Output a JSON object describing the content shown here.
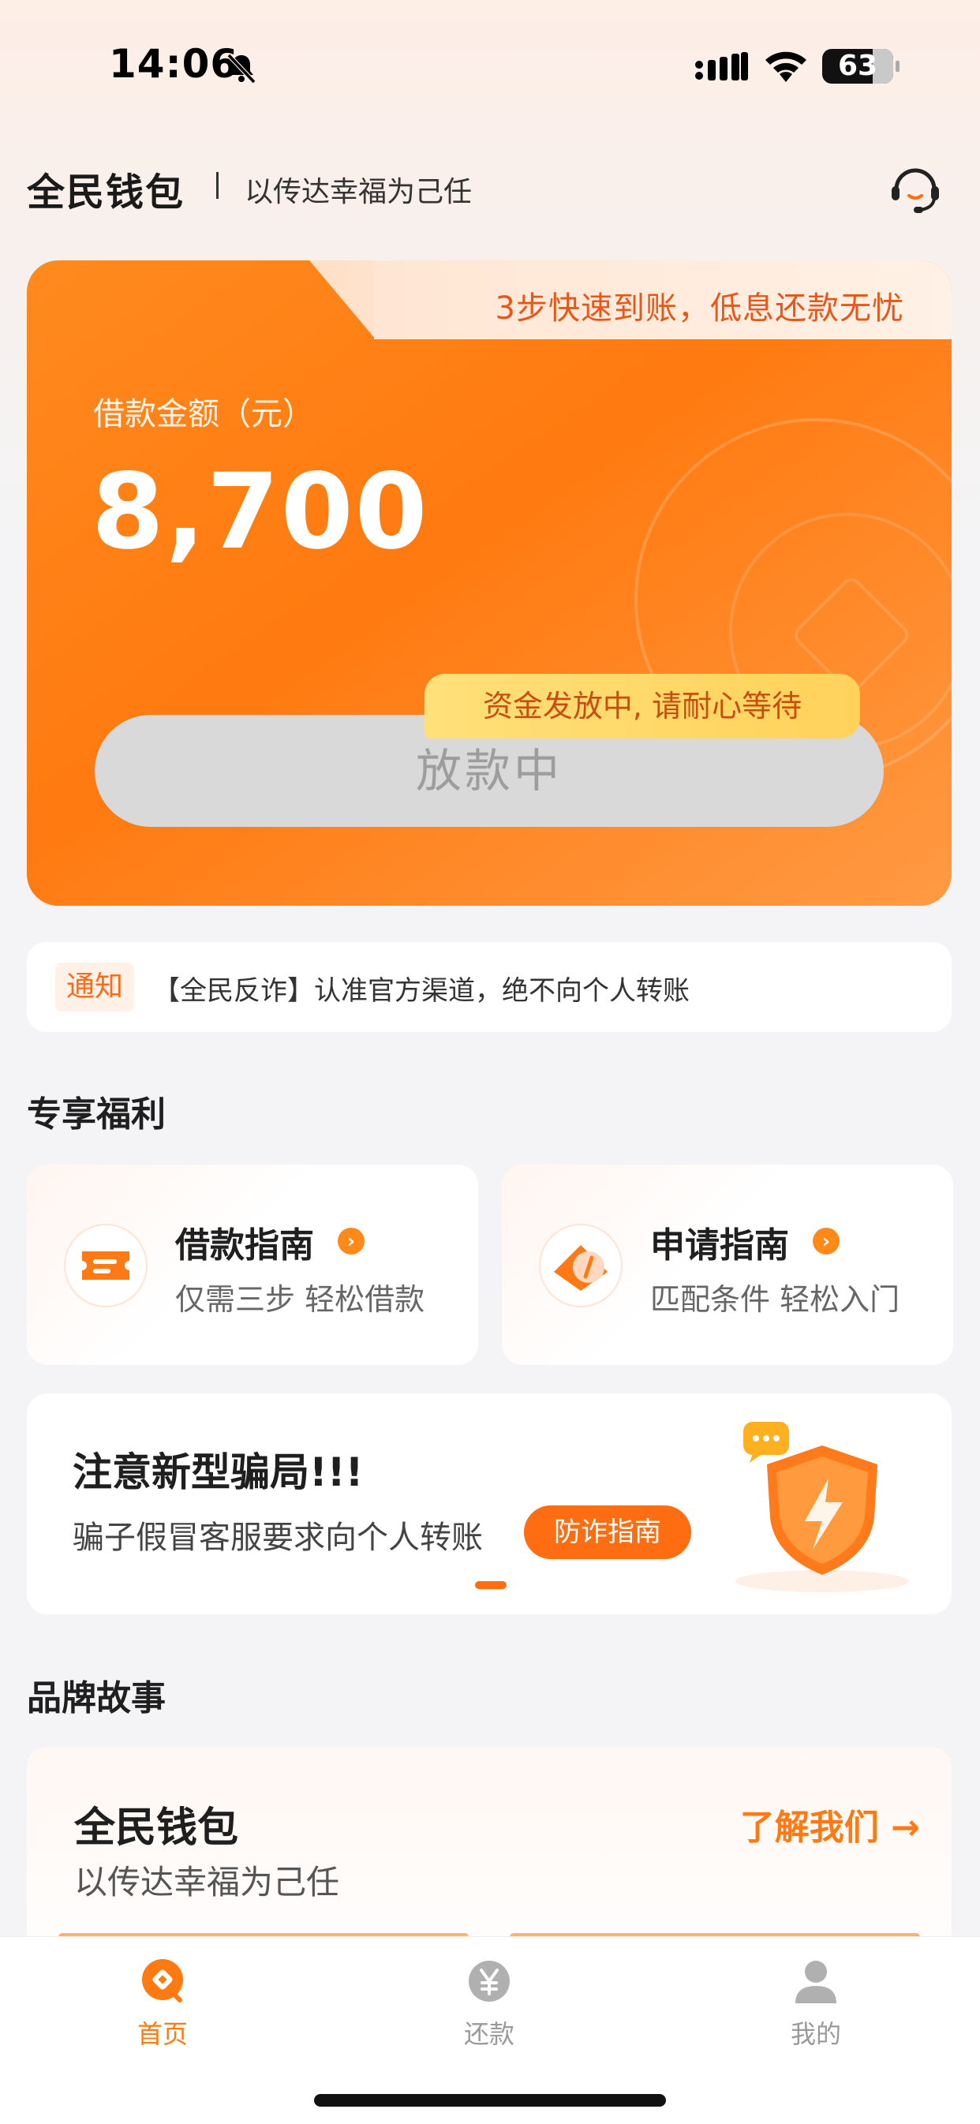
{
  "status_bar": {
    "time": "14:06",
    "battery": "63"
  },
  "header": {
    "brand": "全民钱包",
    "slogan": "以传达幸福为己任"
  },
  "loan_card": {
    "promo": "3步快速到账，低息还款无忧",
    "amount_label": "借款金额（元）",
    "amount": "8,700",
    "tooltip": "资金发放中, 请耐心等待",
    "button_label": "放款中"
  },
  "notice": {
    "tag": "通知",
    "text": "【全民反诈】认准官方渠道，绝不向个人转账"
  },
  "benefits": {
    "title": "专享福利",
    "items": [
      {
        "title": "借款指南",
        "subtitle": "仅需三步 轻松借款",
        "icon": "ticket-icon"
      },
      {
        "title": "申请指南",
        "subtitle": "匹配条件 轻松入门",
        "icon": "compass-icon"
      }
    ]
  },
  "scam_banner": {
    "title": "注意新型骗局!!!",
    "subtitle": "骗子假冒客服要求向个人转账",
    "button": "防诈指南"
  },
  "brand_story": {
    "title": "品牌故事",
    "card_title": "全民钱包",
    "card_subtitle": "以传达幸福为己任",
    "link": "了解我们 →"
  },
  "tab_bar": {
    "items": [
      {
        "label": "首页",
        "active": true
      },
      {
        "label": "还款",
        "active": false
      },
      {
        "label": "我的",
        "active": false
      }
    ]
  },
  "colors": {
    "accent": "#ff7a10",
    "inactive": "#b0b0b0"
  }
}
